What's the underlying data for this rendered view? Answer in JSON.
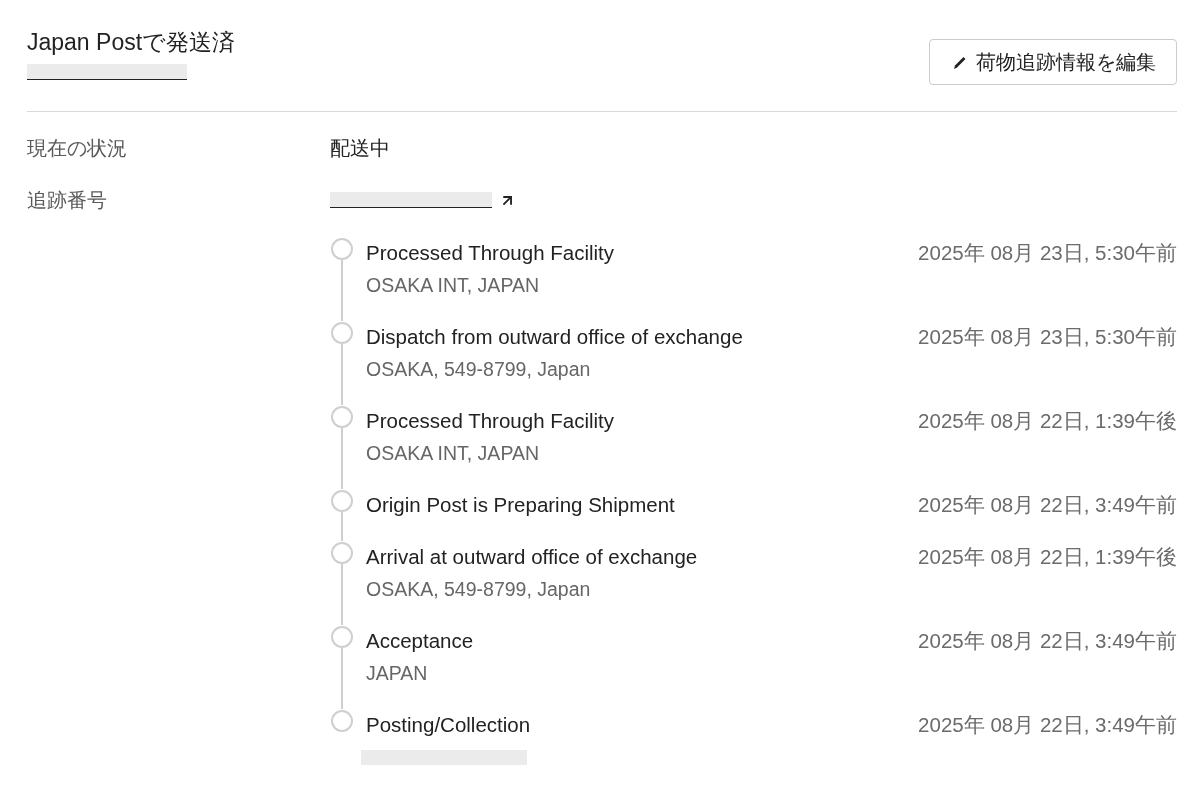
{
  "header": {
    "title": "Japan Postで発送済",
    "tracking_number_redacted": true,
    "edit_button": {
      "label": "荷物追跡情報を編集"
    }
  },
  "details": [
    {
      "kind": "text",
      "label": "現在の状況",
      "value": "配送中"
    },
    {
      "kind": "redacted_link",
      "label": "追跡番号"
    }
  ],
  "events": [
    {
      "title": "Processed Through Facility",
      "location": "OSAKA INT, JAPAN",
      "location_redacted": false,
      "time": "2025年 08月 23日, 5:30午前"
    },
    {
      "title": "Dispatch from outward office of exchange",
      "location": "OSAKA, 549-8799, Japan",
      "location_redacted": false,
      "time": "2025年 08月 23日, 5:30午前"
    },
    {
      "title": "Processed Through Facility",
      "location": "OSAKA INT, JAPAN",
      "location_redacted": false,
      "time": "2025年 08月 22日, 1:39午後"
    },
    {
      "title": "Origin Post is Preparing Shipment",
      "location_redacted": false,
      "time": "2025年 08月 22日, 3:49午前"
    },
    {
      "title": "Arrival at outward office of exchange",
      "location": "OSAKA, 549-8799, Japan",
      "location_redacted": false,
      "time": "2025年 08月 22日, 1:39午後"
    },
    {
      "title": "Acceptance",
      "location": "JAPAN",
      "location_redacted": false,
      "time": "2025年 08月 22日, 3:49午前"
    },
    {
      "title": "Posting/Collection",
      "location_redacted": true,
      "time": "2025年 08月 22日, 3:49午前"
    }
  ]
}
